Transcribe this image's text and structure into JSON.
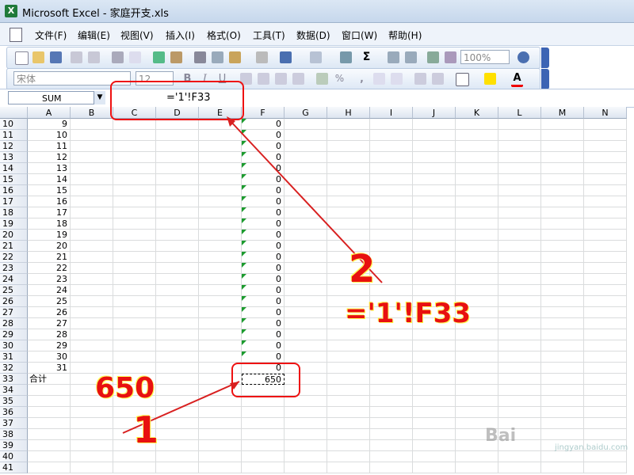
{
  "window": {
    "title": "Microsoft Excel - 家庭开支.xls",
    "app_icon": "X"
  },
  "menu": [
    "文件(F)",
    "编辑(E)",
    "视图(V)",
    "插入(I)",
    "格式(O)",
    "工具(T)",
    "数据(D)",
    "窗口(W)",
    "帮助(H)"
  ],
  "toolbar": {
    "zoom": "100%",
    "font_name": "宋体",
    "font_size": "12"
  },
  "formula_bar": {
    "name_box": "SUM",
    "formula": "='1'!F33"
  },
  "columns": [
    "A",
    "B",
    "C",
    "D",
    "E",
    "F",
    "G",
    "H",
    "I",
    "J",
    "K",
    "L",
    "M",
    "N"
  ],
  "rows": [
    {
      "n": "10",
      "a": "9",
      "f": "0"
    },
    {
      "n": "11",
      "a": "10",
      "f": "0"
    },
    {
      "n": "12",
      "a": "11",
      "f": "0"
    },
    {
      "n": "13",
      "a": "12",
      "f": "0"
    },
    {
      "n": "14",
      "a": "13",
      "f": "0"
    },
    {
      "n": "15",
      "a": "14",
      "f": "0"
    },
    {
      "n": "16",
      "a": "15",
      "f": "0"
    },
    {
      "n": "17",
      "a": "16",
      "f": "0"
    },
    {
      "n": "18",
      "a": "17",
      "f": "0"
    },
    {
      "n": "19",
      "a": "18",
      "f": "0"
    },
    {
      "n": "20",
      "a": "19",
      "f": "0"
    },
    {
      "n": "21",
      "a": "20",
      "f": "0"
    },
    {
      "n": "22",
      "a": "21",
      "f": "0"
    },
    {
      "n": "23",
      "a": "22",
      "f": "0"
    },
    {
      "n": "24",
      "a": "23",
      "f": "0"
    },
    {
      "n": "25",
      "a": "24",
      "f": "0"
    },
    {
      "n": "26",
      "a": "25",
      "f": "0"
    },
    {
      "n": "27",
      "a": "26",
      "f": "0"
    },
    {
      "n": "28",
      "a": "27",
      "f": "0"
    },
    {
      "n": "29",
      "a": "28",
      "f": "0"
    },
    {
      "n": "30",
      "a": "29",
      "f": "0"
    },
    {
      "n": "31",
      "a": "30",
      "f": "0"
    },
    {
      "n": "32",
      "a": "31",
      "f": "0"
    },
    {
      "n": "33",
      "a": "合计",
      "f": "650"
    },
    {
      "n": "34",
      "a": "",
      "f": ""
    },
    {
      "n": "35",
      "a": "",
      "f": ""
    },
    {
      "n": "36",
      "a": "",
      "f": ""
    },
    {
      "n": "37",
      "a": "",
      "f": ""
    },
    {
      "n": "38",
      "a": "",
      "f": ""
    },
    {
      "n": "39",
      "a": "",
      "f": ""
    },
    {
      "n": "40",
      "a": "",
      "f": ""
    },
    {
      "n": "41",
      "a": "",
      "f": ""
    }
  ],
  "annotations": {
    "label_1": "1",
    "label_2": "2",
    "value_label": "650",
    "formula_label": "='1'!F33"
  },
  "watermark": {
    "text": "Bai",
    "sub": "jingyan.baidu.com"
  },
  "colors": {
    "annotation_red": "#e81010",
    "highlight": "#ffff00"
  }
}
